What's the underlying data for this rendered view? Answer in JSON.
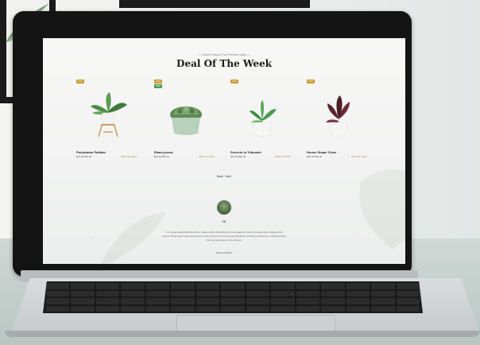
{
  "site": {
    "eyebrow": "— Great Product From Relecet plant —",
    "section_title": "Deal Of The Week",
    "pager": {
      "prev": "Back",
      "next": "Next"
    },
    "avatar_name": "Hi",
    "testimonial": "It is a long established fact that a reader will be distracted by the readable content of a page when looking at its layout. All the lorem ipsum generators on the Internet tend to repeat predefined chunks as necessary, making this the first true generator on the Internet.",
    "footer": "JOHN CHARNY"
  },
  "products": [
    {
      "name": "Parlywaran Pafidan",
      "price": "$40.00  $30.00",
      "cart": "ADD TO CART",
      "badge": "SALE",
      "badge_color": "#c99a2e",
      "plant": "potted-plant"
    },
    {
      "name": "Ebam pussa",
      "price": "$40.00  $30.00",
      "cart": "ADD TO CART",
      "badge": "SALE",
      "badge_color": "#c99a2e",
      "badge2": "NEW",
      "badge2_color": "#4f9a4f",
      "plant": "succulent"
    },
    {
      "name": "Senecio la Tribunale",
      "price": "$40.00  $30.00",
      "cart": "ADD TO CART",
      "badge": "SALE",
      "badge_color": "#c99a2e",
      "plant": "small-plant"
    },
    {
      "name": "House Shape Close",
      "price": "$40.00  $30.00",
      "cart": "ADD TO CART",
      "badge": "SALE",
      "badge_color": "#c99a2e",
      "plant": "burgundy-plant"
    }
  ],
  "colors": {
    "accent": "#c99a2e",
    "new_badge": "#4f9a4f",
    "screen_bg": "#f3f4f3",
    "bezel": "#141414"
  }
}
